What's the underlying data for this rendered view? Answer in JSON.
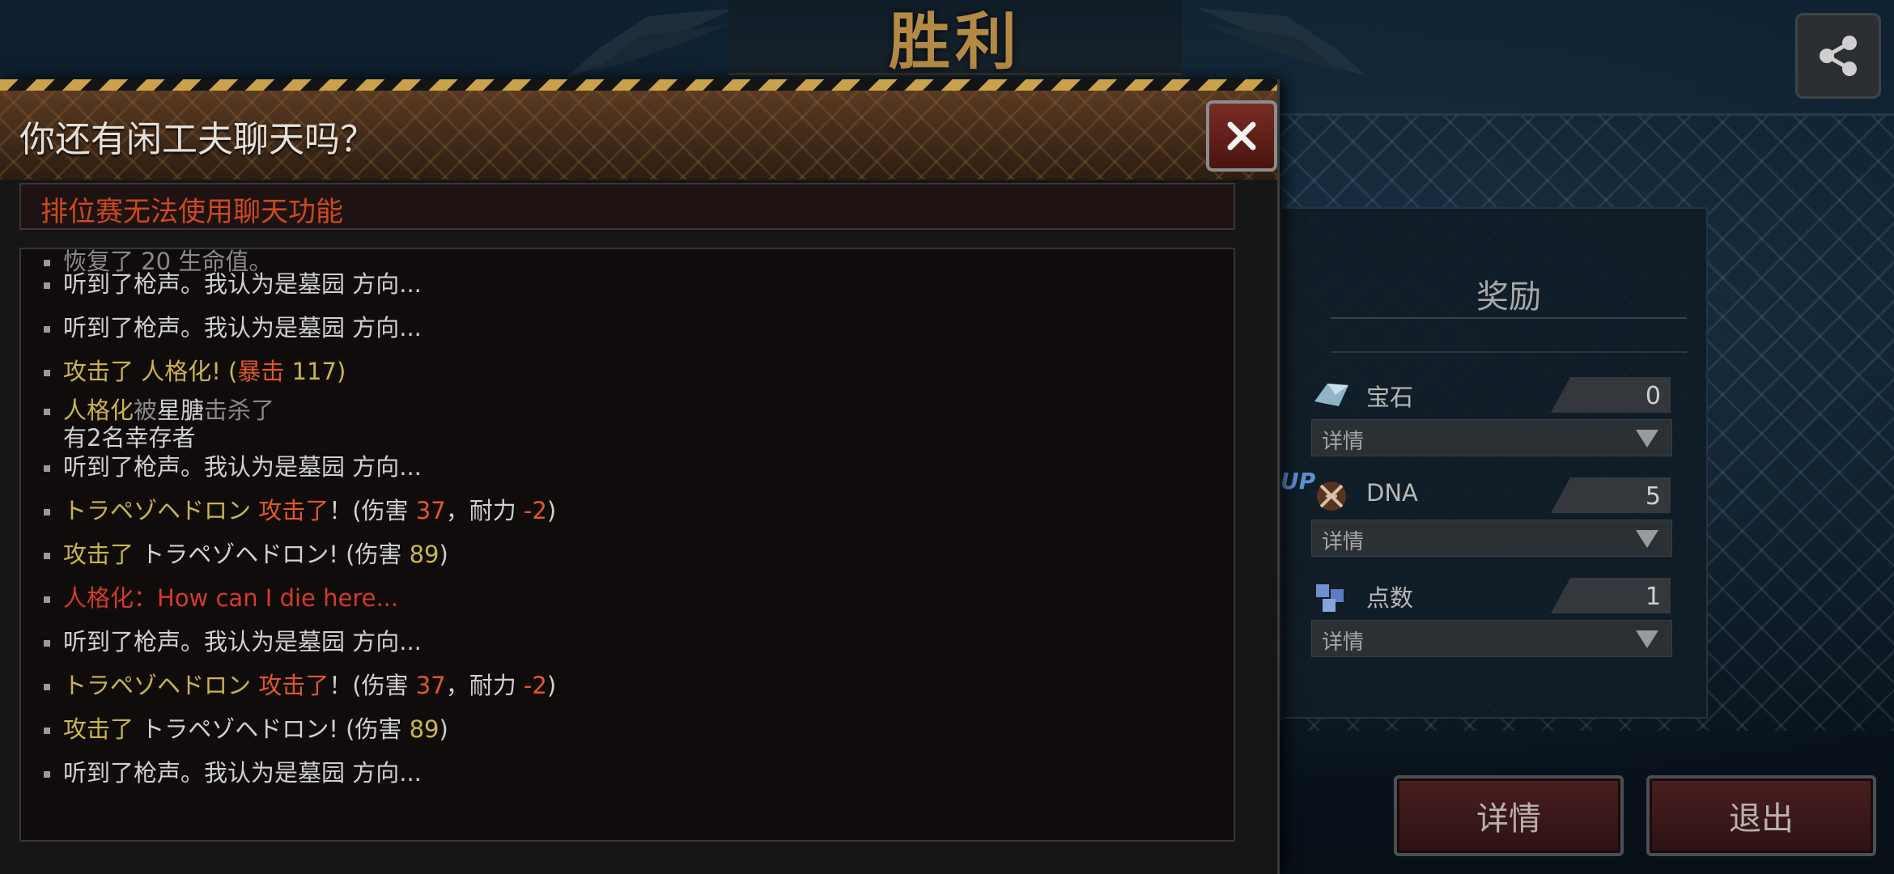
{
  "victory": {
    "title": "胜利"
  },
  "icons": {
    "share": "share-icon",
    "close": "close-icon",
    "gem": "gem-icon",
    "dna": "dna-icon",
    "points": "cube-icon",
    "dropdown": "triangle-down-icon"
  },
  "colors": {
    "accent_gold": "#b38a45",
    "notice_red": "#cc4a1e",
    "chat_olive": "#c9b64a",
    "chat_red": "#d23a2a"
  },
  "rewards": {
    "title": "奖励",
    "up_badge": "UP",
    "items": [
      {
        "label": "宝石",
        "value": "0",
        "detail": "详情"
      },
      {
        "label": "DNA",
        "value": "5",
        "detail": "详情"
      },
      {
        "label": "点数",
        "value": "1",
        "detail": "详情"
      }
    ]
  },
  "buttons": {
    "details": "详情",
    "exit": "退出"
  },
  "chat": {
    "title": "你还有闲工夫聊天吗？",
    "notice": "排位赛无法使用聊天功能",
    "partial_top": "恢复了 20 生命值。",
    "lines": [
      {
        "parts": [
          {
            "t": "听到了枪声。我认为是",
            "c": "white"
          },
          {
            "t": "墓园",
            "c": "white"
          },
          {
            "t": " 方向...",
            "c": "white"
          }
        ]
      },
      {
        "parts": [
          {
            "t": "听到了枪声。我认为是",
            "c": "white"
          },
          {
            "t": "墓园",
            "c": "white"
          },
          {
            "t": " 方向...",
            "c": "white"
          }
        ]
      },
      {
        "parts": [
          {
            "t": "攻击了 人格化! (",
            "c": "olive"
          },
          {
            "t": "暴击 ",
            "c": "orange"
          },
          {
            "t": "117)",
            "c": "olive"
          }
        ]
      },
      {
        "parts": [
          {
            "t": "人格化",
            "c": "olive"
          },
          {
            "t": "被",
            "c": "gray"
          },
          {
            "t": "星膅",
            "c": "white"
          },
          {
            "t": "击杀了",
            "c": "gray"
          }
        ],
        "second": "有2名幸存者"
      },
      {
        "parts": [
          {
            "t": "听到了枪声。我认为是",
            "c": "white"
          },
          {
            "t": "墓园",
            "c": "white"
          },
          {
            "t": " 方向...",
            "c": "white"
          }
        ]
      },
      {
        "parts": [
          {
            "t": "トラペゾヘドロン  ",
            "c": "olive"
          },
          {
            "t": "攻击了",
            "c": "orange"
          },
          {
            "t": "！(伤害 ",
            "c": "white"
          },
          {
            "t": "37",
            "c": "orange"
          },
          {
            "t": "，耐力  ",
            "c": "white"
          },
          {
            "t": "-2",
            "c": "orange"
          },
          {
            "t": ")",
            "c": "white"
          }
        ]
      },
      {
        "parts": [
          {
            "t": "攻击了 ",
            "c": "olive"
          },
          {
            "t": "トラペゾヘドロン! (伤害 ",
            "c": "white"
          },
          {
            "t": "89",
            "c": "olive"
          },
          {
            "t": ")",
            "c": "white"
          }
        ]
      },
      {
        "parts": [
          {
            "t": "人格化：How can I die here...",
            "c": "red"
          }
        ]
      },
      {
        "parts": [
          {
            "t": "听到了枪声。我认为是",
            "c": "white"
          },
          {
            "t": "墓园",
            "c": "white"
          },
          {
            "t": " 方向...",
            "c": "white"
          }
        ]
      },
      {
        "parts": [
          {
            "t": "トラペゾヘドロン  ",
            "c": "olive"
          },
          {
            "t": "攻击了",
            "c": "orange"
          },
          {
            "t": "！(伤害 ",
            "c": "white"
          },
          {
            "t": "37",
            "c": "orange"
          },
          {
            "t": "，耐力  ",
            "c": "white"
          },
          {
            "t": "-2",
            "c": "orange"
          },
          {
            "t": ")",
            "c": "white"
          }
        ]
      },
      {
        "parts": [
          {
            "t": "攻击了 ",
            "c": "olive"
          },
          {
            "t": "トラペゾヘドロン! (伤害 ",
            "c": "white"
          },
          {
            "t": "89",
            "c": "olive"
          },
          {
            "t": ")",
            "c": "white"
          }
        ]
      },
      {
        "parts": [
          {
            "t": "听到了枪声。我认为是",
            "c": "white"
          },
          {
            "t": "墓园",
            "c": "white"
          },
          {
            "t": " 方向...",
            "c": "white"
          }
        ]
      }
    ]
  }
}
